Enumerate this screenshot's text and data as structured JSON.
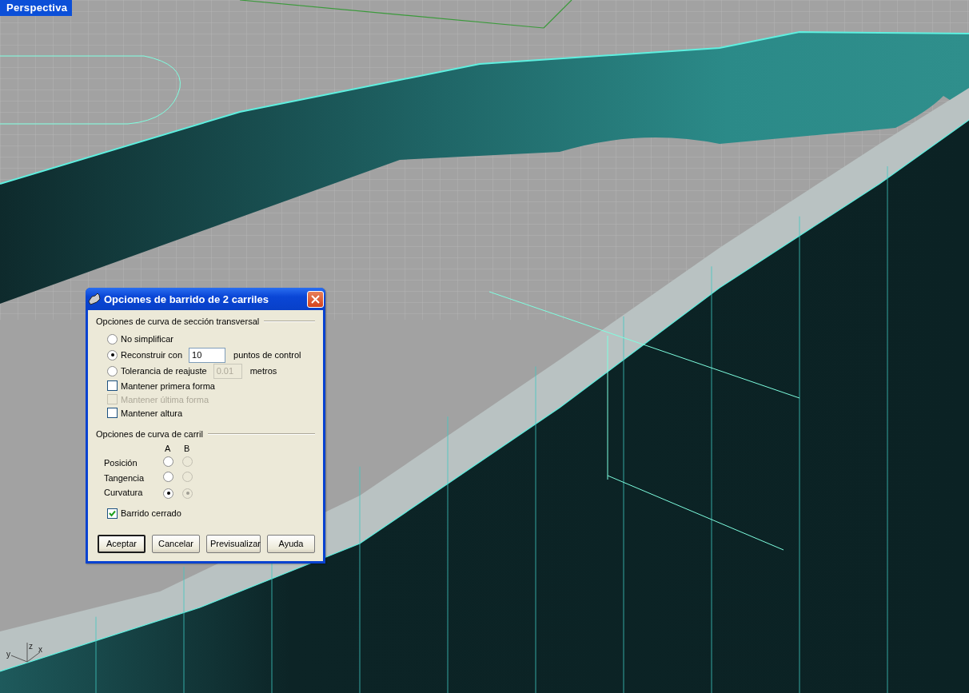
{
  "viewport": {
    "title": "Perspectiva",
    "axis_labels": [
      "z",
      "y",
      "x"
    ]
  },
  "dialog": {
    "title": "Opciones de barrido de 2 carriles",
    "cross_section": {
      "title": "Opciones de curva de sección transversal",
      "options": [
        {
          "kind": "radio",
          "label": "No simplificar",
          "selected": false
        },
        {
          "kind": "radio",
          "label": "Reconstruir con",
          "selected": true,
          "value": "10",
          "suffix": "puntos de control",
          "field_disabled": false
        },
        {
          "kind": "radio",
          "label": "Tolerancia de reajuste",
          "selected": false,
          "value": "0.01",
          "suffix": "metros",
          "field_disabled": true
        },
        {
          "kind": "checkbox",
          "label": "Mantener primera forma",
          "checked": false,
          "disabled": false
        },
        {
          "kind": "checkbox",
          "label": "Mantener última forma",
          "checked": false,
          "disabled": true
        },
        {
          "kind": "checkbox",
          "label": "Mantener altura",
          "checked": false,
          "disabled": false
        }
      ]
    },
    "rail": {
      "title": "Opciones de curva de carril",
      "columns": [
        "A",
        "B"
      ],
      "rows": [
        {
          "label": "Posición",
          "options": [
            {
              "selected": false,
              "disabled": false
            },
            {
              "selected": false,
              "disabled": true
            }
          ]
        },
        {
          "label": "Tangencia",
          "options": [
            {
              "selected": false,
              "disabled": false
            },
            {
              "selected": false,
              "disabled": true
            }
          ]
        },
        {
          "label": "Curvatura",
          "options": [
            {
              "selected": true,
              "disabled": false
            },
            {
              "selected": true,
              "disabled": true
            }
          ]
        }
      ]
    },
    "closed_sweep": {
      "label": "Barrido cerrado",
      "checked": true,
      "disabled": false
    },
    "buttons": [
      {
        "label": "Aceptar",
        "default": true
      },
      {
        "label": "Cancelar",
        "default": false
      },
      {
        "label": "Previsualizar",
        "default": false
      },
      {
        "label": "Ayuda",
        "default": false
      }
    ]
  }
}
